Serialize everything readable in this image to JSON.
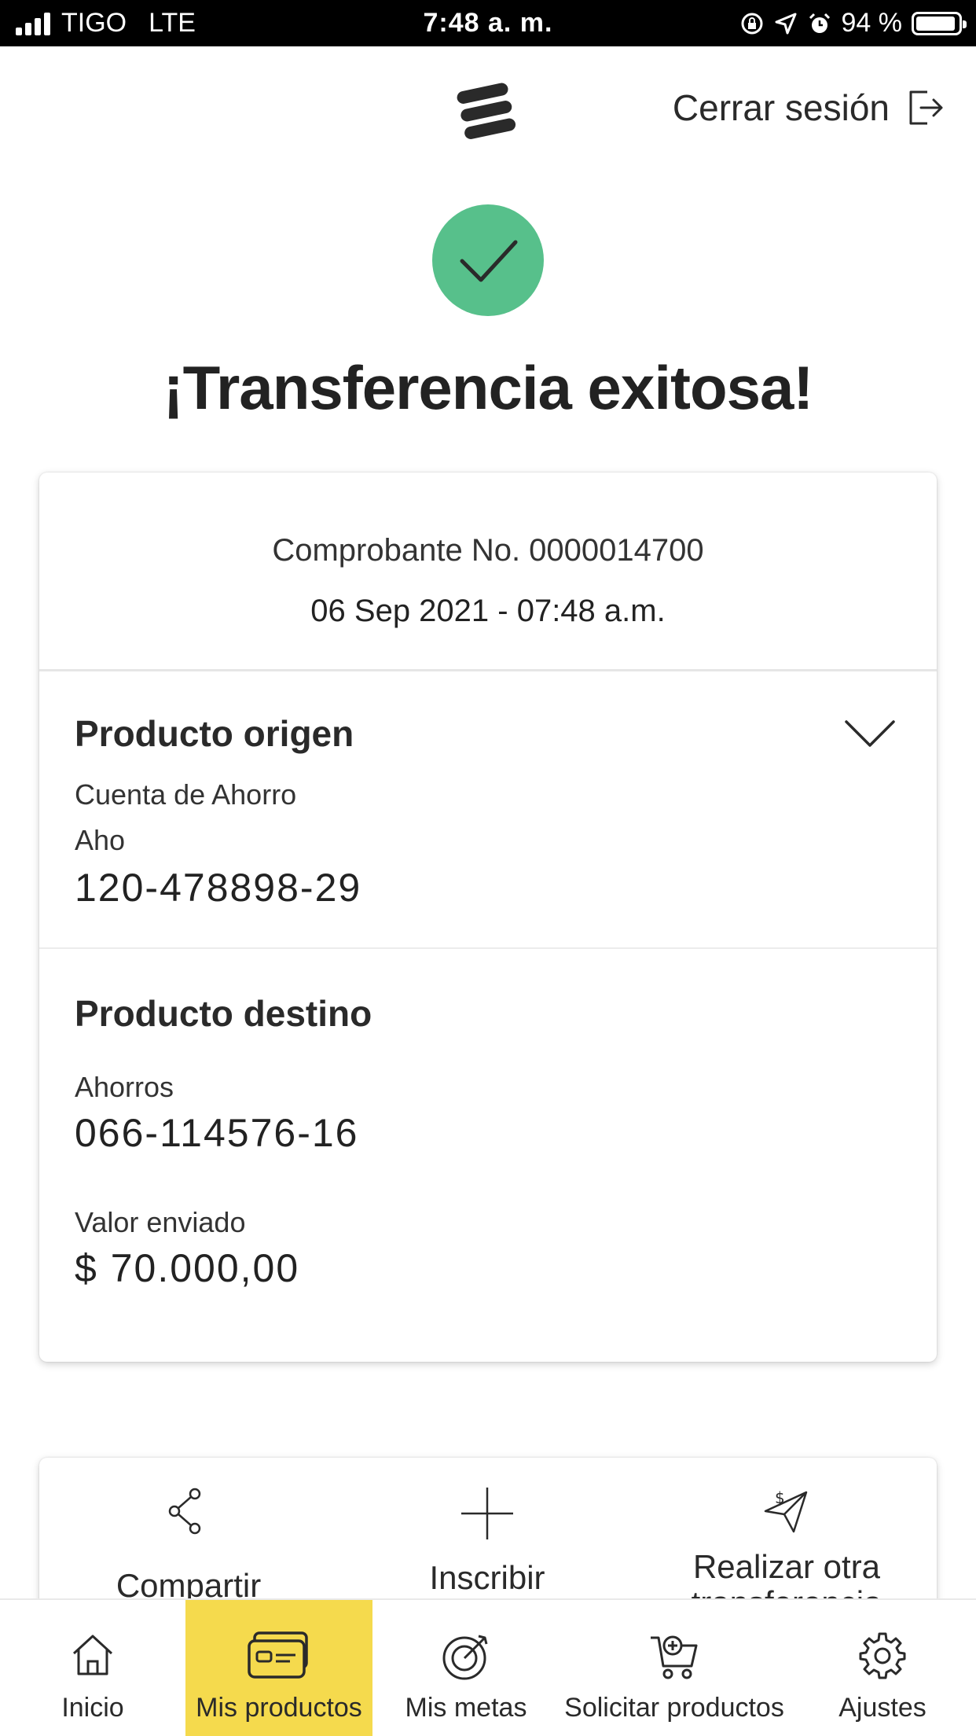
{
  "status_bar": {
    "carrier": "TIGO",
    "network": "LTE",
    "time": "7:48 a. m.",
    "battery": "94 %",
    "battery_level": 0.94
  },
  "header": {
    "logout_label": "Cerrar sesión",
    "logo_icon": "bank-logo-icon",
    "logout_icon": "logout-icon"
  },
  "success": {
    "title": "¡Transferencia exitosa!",
    "icon": "check-icon",
    "color": "#57c08b"
  },
  "receipt": {
    "number": "Comprobante No. 0000014700",
    "datetime": "06 Sep 2021 - 07:48 a.m."
  },
  "origin": {
    "title": "Producto origen",
    "account_type": "Cuenta de Ahorro",
    "account_name": "Aho",
    "account_number": "120-478898-29",
    "toggle_icon": "chevron-down-icon"
  },
  "destination": {
    "title": "Producto destino",
    "account_type": "Ahorros",
    "account_number": "066-114576-16",
    "amount_label": "Valor enviado",
    "amount": "$ 70.000,00"
  },
  "actions": [
    {
      "label": "Compartir",
      "icon": "share-icon"
    },
    {
      "label": "Inscribir",
      "icon": "plus-icon"
    },
    {
      "label": "Realizar otra transferencia",
      "label_line1": "Realizar otra",
      "label_line2": "transferencia",
      "icon": "send-money-icon"
    }
  ],
  "tabs": [
    {
      "label": "Inicio",
      "icon": "home-icon",
      "active": false
    },
    {
      "label": "Mis productos",
      "icon": "wallet-cards-icon",
      "active": true
    },
    {
      "label": "Mis metas",
      "icon": "target-icon",
      "active": false
    },
    {
      "label": "Solicitar productos",
      "icon": "cart-add-icon",
      "active": false
    },
    {
      "label": "Ajustes",
      "icon": "gear-icon",
      "active": false
    }
  ],
  "colors": {
    "accent_yellow": "#f5da4d",
    "success_green": "#57c08b",
    "text_dark": "#2a2a2a"
  }
}
